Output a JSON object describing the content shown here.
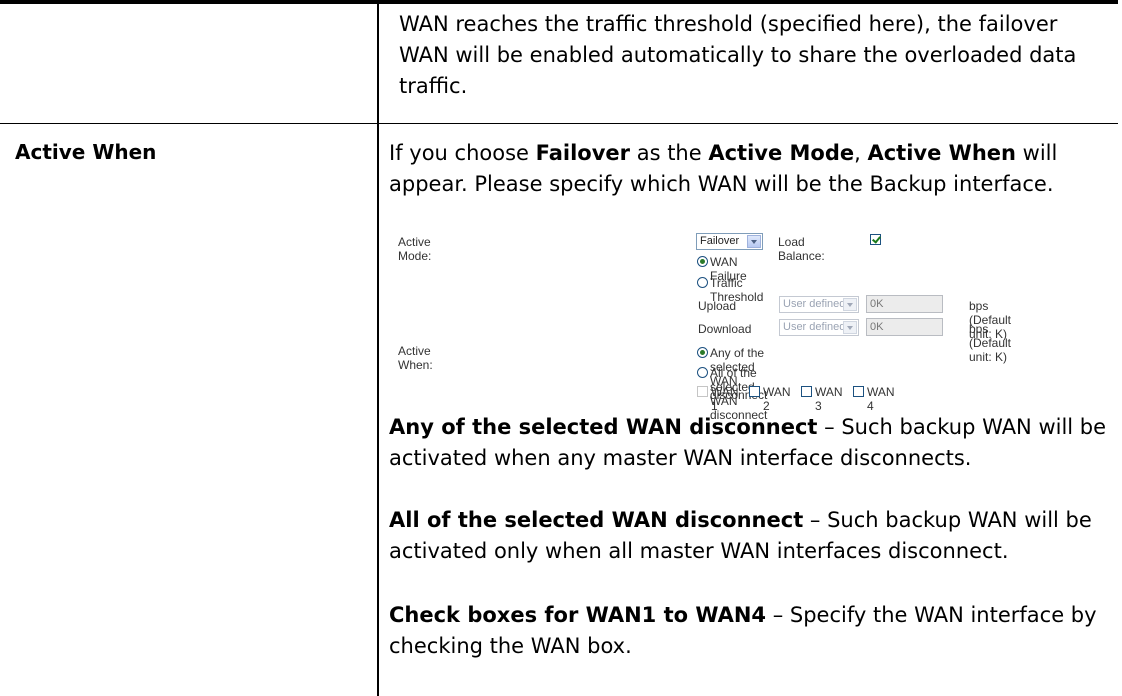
{
  "top_cell": {
    "continuation_text": "WAN reaches the traffic threshold (specified here), the failover WAN will be enabled automatically to share the overloaded data traffic."
  },
  "row": {
    "label": "Active When",
    "intro": {
      "t1": "If you choose ",
      "b1": "Failover",
      "t2": " as the ",
      "b2": "Active Mode",
      "t3": ", ",
      "b3": "Active When",
      "t4": " will appear. Please specify which WAN will be the Backup interface."
    },
    "any_term": "Any of the selected WAN disconnect",
    "any_desc": " – Such backup WAN will be activated when any master WAN interface disconnects.",
    "all_term": "All of the selected WAN disconnect",
    "all_desc": " – Such backup WAN will be activated only when all master WAN interfaces disconnect.",
    "check_term": "Check boxes for WAN1 to WAN4",
    "check_desc": " – Specify the WAN interface by checking the WAN box."
  },
  "ui": {
    "active_mode_label": "Active Mode:",
    "active_mode_value": "Failover",
    "load_balance_label": "Load Balance:",
    "load_balance_checked": true,
    "wan_failure_label": "WAN Failure",
    "traffic_threshold_label": "Traffic Threshold",
    "upload_label": "Upload",
    "download_label": "Download",
    "unit_select_value": "User defined",
    "upload_value": "0K",
    "download_value": "0K",
    "bps_note": "bps (Default unit: K)",
    "active_when_label": "Active When:",
    "any_option": "Any of the selected WAN disconnect",
    "all_option": "All of the selected WAN disconnect",
    "wan_boxes": [
      "WAN 1",
      "WAN 2",
      "WAN 3",
      "WAN 4"
    ]
  }
}
